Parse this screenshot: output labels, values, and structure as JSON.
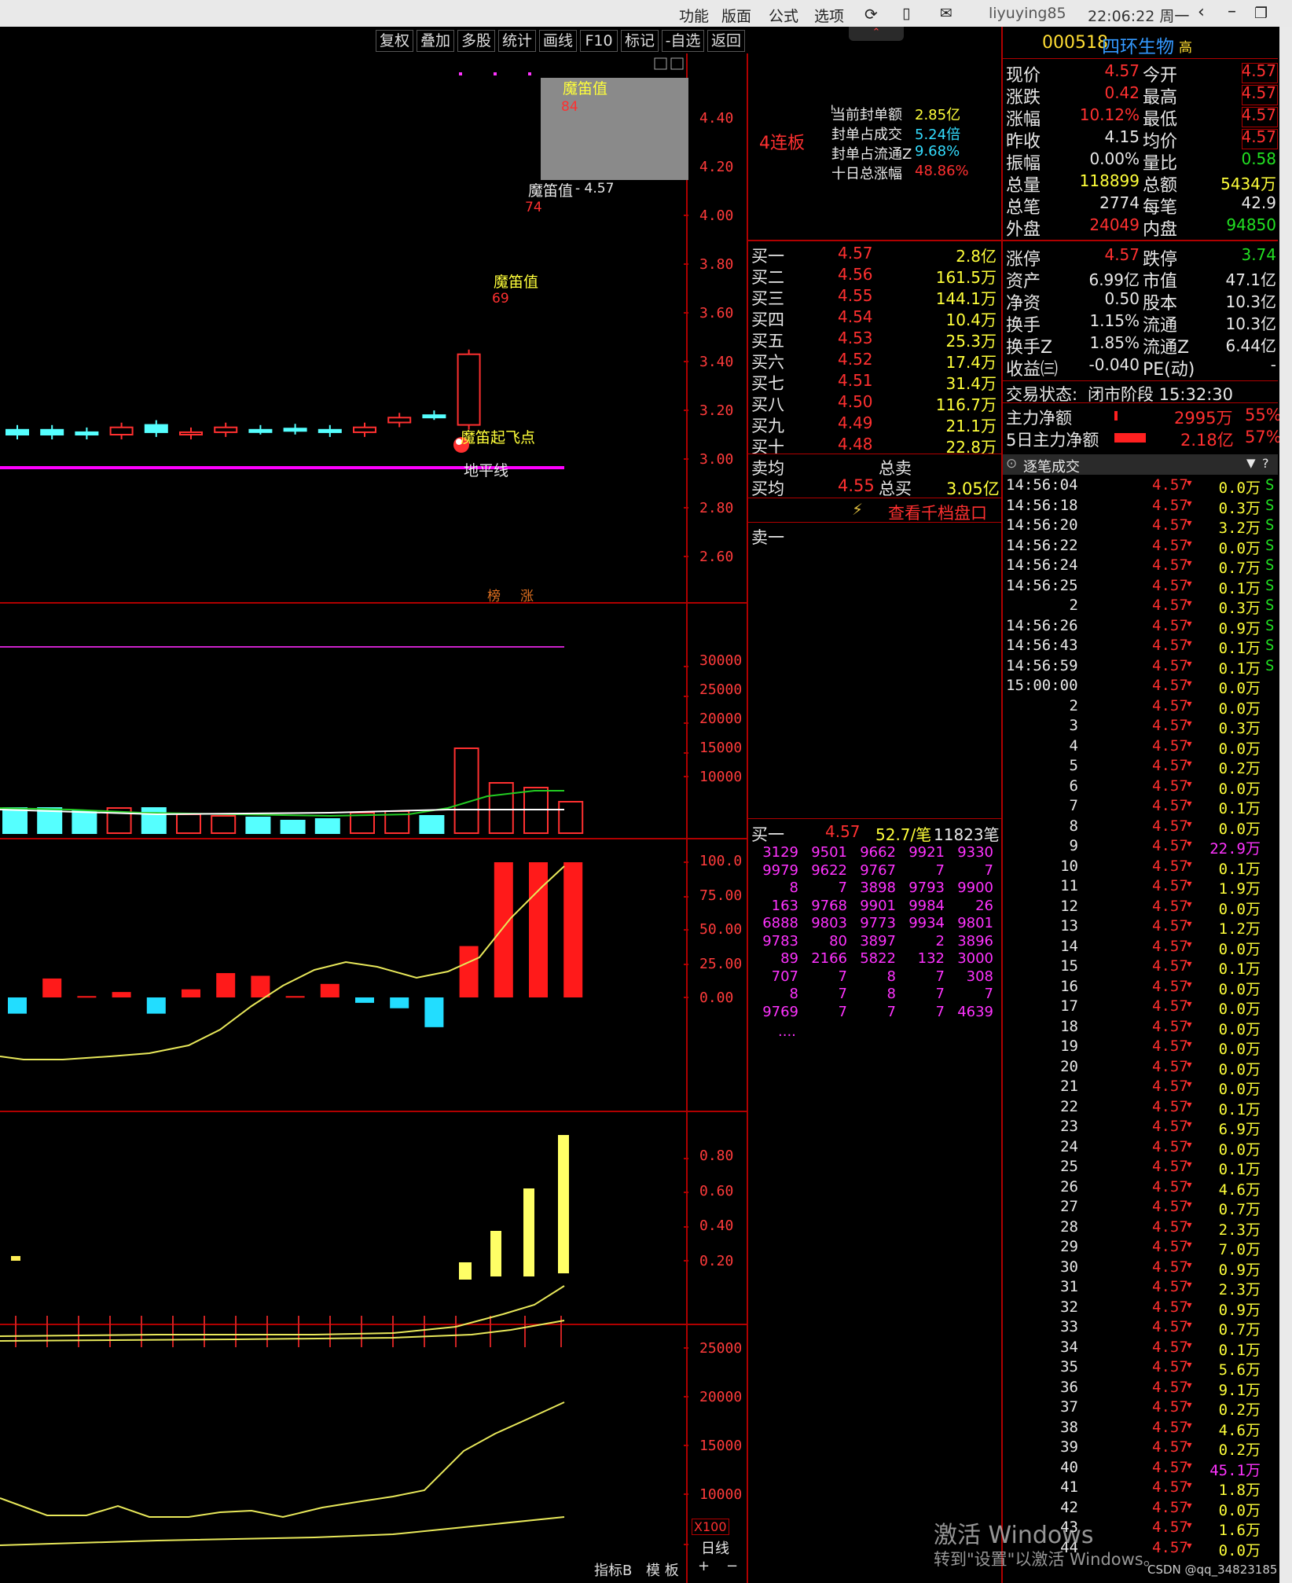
{
  "menubar": {
    "items": [
      "功能",
      "版面",
      "公式",
      "选项"
    ],
    "user": "liyuying85",
    "clock": "22:06:22 周一"
  },
  "toolbar": [
    "复权",
    "叠加",
    "多股",
    "统计",
    "画线",
    "F10",
    "标记",
    "-自选",
    "返回"
  ],
  "chart": {
    "price_axis": [
      "4.40",
      "4.20",
      "4.00",
      "3.80",
      "3.60",
      "3.40",
      "3.20",
      "3.00",
      "2.80",
      "2.60"
    ],
    "vol_axis": [
      "30000",
      "25000",
      "20000",
      "15000",
      "10000"
    ],
    "ind1_axis": [
      "100.0",
      "75.00",
      "50.00",
      "25.00",
      "0.00"
    ],
    "ind2_axis": [
      "0.80",
      "0.60",
      "0.40",
      "0.20"
    ],
    "ind3_axis": [
      "25000",
      "20000",
      "15000",
      "10000"
    ],
    "labels": {
      "modi1": "魔笛值",
      "modi1_val": "84",
      "modi2": "魔笛值",
      "modi2_price": "- 4.57",
      "modi2_val": "74",
      "modi3": "魔笛值",
      "modi3_val": "69",
      "qifei": "魔笛起飞点",
      "dipingxian": "地平线",
      "bang": "榜",
      "zhang": "涨",
      "x100": "X100",
      "rixian": "日线",
      "zhibiao": "指标B",
      "moban": "模 板"
    }
  },
  "limit_info": {
    "lianban": "4连板",
    "rows": [
      [
        "当前封单额",
        "2.85亿"
      ],
      [
        "封单占成交",
        "5.24倍"
      ],
      [
        "封单占流通Z",
        "9.68%"
      ],
      [
        "十日总涨幅",
        "48.86%"
      ]
    ]
  },
  "order_book": {
    "buys": [
      [
        "买一",
        "4.57",
        "2.8亿"
      ],
      [
        "买二",
        "4.56",
        "161.5万"
      ],
      [
        "买三",
        "4.55",
        "144.1万"
      ],
      [
        "买四",
        "4.54",
        "10.4万"
      ],
      [
        "买五",
        "4.53",
        "25.3万"
      ],
      [
        "买六",
        "4.52",
        "17.4万"
      ],
      [
        "买七",
        "4.51",
        "31.4万"
      ],
      [
        "买八",
        "4.50",
        "116.7万"
      ],
      [
        "买九",
        "4.49",
        "21.1万"
      ],
      [
        "买十",
        "4.48",
        "22.8万"
      ]
    ],
    "sell_avg": "卖均",
    "total_sell": "总卖",
    "buy_avg": "买均",
    "buy_avg_price": "4.55",
    "total_buy": "总买",
    "total_buy_val": "3.05亿",
    "view_more": "查看千档盘口",
    "sell1": "卖一",
    "queue_header": [
      "买一",
      "4.57",
      "52.7/笔",
      "11823笔"
    ],
    "queue": [
      [
        "3129",
        "9501",
        "9662",
        "9921",
        "9330"
      ],
      [
        "9979",
        "9622",
        "9767",
        "7",
        "7"
      ],
      [
        "8",
        "7",
        "3898",
        "9793",
        "9900"
      ],
      [
        "163",
        "9768",
        "9901",
        "9984",
        "26"
      ],
      [
        "6888",
        "9803",
        "9773",
        "9934",
        "9801"
      ],
      [
        "9783",
        "80",
        "3897",
        "2",
        "3896"
      ],
      [
        "89",
        "2166",
        "5822",
        "132",
        "3000"
      ],
      [
        "707",
        "7",
        "8",
        "7",
        "308"
      ],
      [
        "8",
        "7",
        "8",
        "7",
        "7"
      ],
      [
        "9769",
        "7",
        "7",
        "7",
        "4639"
      ]
    ],
    "queue_more": "...."
  },
  "quote": {
    "code": "000518",
    "name": "四环生物",
    "tag": "高",
    "rows": [
      [
        "现价",
        "4.57",
        "今开",
        "4.57"
      ],
      [
        "涨跌",
        "0.42",
        "最高",
        "4.57"
      ],
      [
        "涨幅",
        "10.12%",
        "最低",
        "4.57"
      ],
      [
        "昨收",
        "4.15",
        "均价",
        "4.57"
      ],
      [
        "振幅",
        "0.00%",
        "量比",
        "0.58"
      ],
      [
        "总量",
        "118899",
        "总额",
        "5434万"
      ],
      [
        "总笔",
        "2774",
        "每笔",
        "42.9"
      ],
      [
        "外盘",
        "24049",
        "内盘",
        "94850"
      ],
      [
        "涨停",
        "4.57",
        "跌停",
        "3.74"
      ],
      [
        "资产",
        "6.99亿",
        "市值",
        "47.1亿"
      ],
      [
        "净资",
        "0.50",
        "股本",
        "10.3亿"
      ],
      [
        "换手",
        "1.15%",
        "流通",
        "10.3亿"
      ],
      [
        "换手Z",
        "1.85%",
        "流通Z",
        "6.44亿"
      ],
      [
        "收益㈢",
        "-0.040",
        "PE(动)",
        "-"
      ]
    ],
    "status_label": "交易状态:",
    "status": "闭市阶段 15:32:30",
    "main_net_label": "主力净额",
    "main_net": "2995万",
    "main_net_pct": "55%",
    "main5_label": "5日主力净额",
    "main5": "2.18亿",
    "main5_pct": "57%",
    "ticks_title": "逐笔成交"
  },
  "ticks": [
    [
      "14:56:04",
      "4.57",
      "0.0万",
      "S"
    ],
    [
      "14:56:18",
      "4.57",
      "0.3万",
      "S"
    ],
    [
      "14:56:20",
      "4.57",
      "3.2万",
      "S"
    ],
    [
      "14:56:22",
      "4.57",
      "0.0万",
      "S"
    ],
    [
      "14:56:24",
      "4.57",
      "0.7万",
      "S"
    ],
    [
      "14:56:25",
      "4.57",
      "0.1万",
      "S"
    ],
    [
      "2",
      "4.57",
      "0.3万",
      "S"
    ],
    [
      "14:56:26",
      "4.57",
      "0.9万",
      "S"
    ],
    [
      "14:56:43",
      "4.57",
      "0.1万",
      "S"
    ],
    [
      "14:56:59",
      "4.57",
      "0.1万",
      "S"
    ],
    [
      "15:00:00",
      "4.57",
      "0.0万",
      ""
    ],
    [
      "2",
      "4.57",
      "0.0万",
      ""
    ],
    [
      "3",
      "4.57",
      "0.3万",
      ""
    ],
    [
      "4",
      "4.57",
      "0.0万",
      ""
    ],
    [
      "5",
      "4.57",
      "0.2万",
      ""
    ],
    [
      "6",
      "4.57",
      "0.0万",
      ""
    ],
    [
      "7",
      "4.57",
      "0.1万",
      ""
    ],
    [
      "8",
      "4.57",
      "0.0万",
      ""
    ],
    [
      "9",
      "4.57",
      "22.9万",
      ""
    ],
    [
      "10",
      "4.57",
      "0.1万",
      ""
    ],
    [
      "11",
      "4.57",
      "1.9万",
      ""
    ],
    [
      "12",
      "4.57",
      "0.0万",
      ""
    ],
    [
      "13",
      "4.57",
      "1.2万",
      ""
    ],
    [
      "14",
      "4.57",
      "0.0万",
      ""
    ],
    [
      "15",
      "4.57",
      "0.1万",
      ""
    ],
    [
      "16",
      "4.57",
      "0.0万",
      ""
    ],
    [
      "17",
      "4.57",
      "0.0万",
      ""
    ],
    [
      "18",
      "4.57",
      "0.0万",
      ""
    ],
    [
      "19",
      "4.57",
      "0.0万",
      ""
    ],
    [
      "20",
      "4.57",
      "0.0万",
      ""
    ],
    [
      "21",
      "4.57",
      "0.0万",
      ""
    ],
    [
      "22",
      "4.57",
      "0.1万",
      ""
    ],
    [
      "23",
      "4.57",
      "6.9万",
      ""
    ],
    [
      "24",
      "4.57",
      "0.0万",
      ""
    ],
    [
      "25",
      "4.57",
      "0.1万",
      ""
    ],
    [
      "26",
      "4.57",
      "4.6万",
      ""
    ],
    [
      "27",
      "4.57",
      "0.7万",
      ""
    ],
    [
      "28",
      "4.57",
      "2.3万",
      ""
    ],
    [
      "29",
      "4.57",
      "7.0万",
      ""
    ],
    [
      "30",
      "4.57",
      "0.9万",
      ""
    ],
    [
      "31",
      "4.57",
      "2.3万",
      ""
    ],
    [
      "32",
      "4.57",
      "0.9万",
      ""
    ],
    [
      "33",
      "4.57",
      "0.7万",
      ""
    ],
    [
      "34",
      "4.57",
      "0.1万",
      ""
    ],
    [
      "35",
      "4.57",
      "5.6万",
      ""
    ],
    [
      "36",
      "4.57",
      "9.1万",
      ""
    ],
    [
      "37",
      "4.57",
      "0.2万",
      ""
    ],
    [
      "38",
      "4.57",
      "4.6万",
      ""
    ],
    [
      "39",
      "4.57",
      "0.2万",
      ""
    ],
    [
      "40",
      "4.57",
      "45.1万",
      ""
    ],
    [
      "41",
      "4.57",
      "1.8万",
      ""
    ],
    [
      "42",
      "4.57",
      "0.0万",
      ""
    ],
    [
      "43",
      "4.57",
      "1.6万",
      ""
    ],
    [
      "44",
      "4.57",
      "0.0万",
      ""
    ]
  ],
  "watermark": {
    "line1": "激活 Windows",
    "line2": "转到\"设置\"以激活 Windows。",
    "csdn": "CSDN @qq_34823185"
  }
}
